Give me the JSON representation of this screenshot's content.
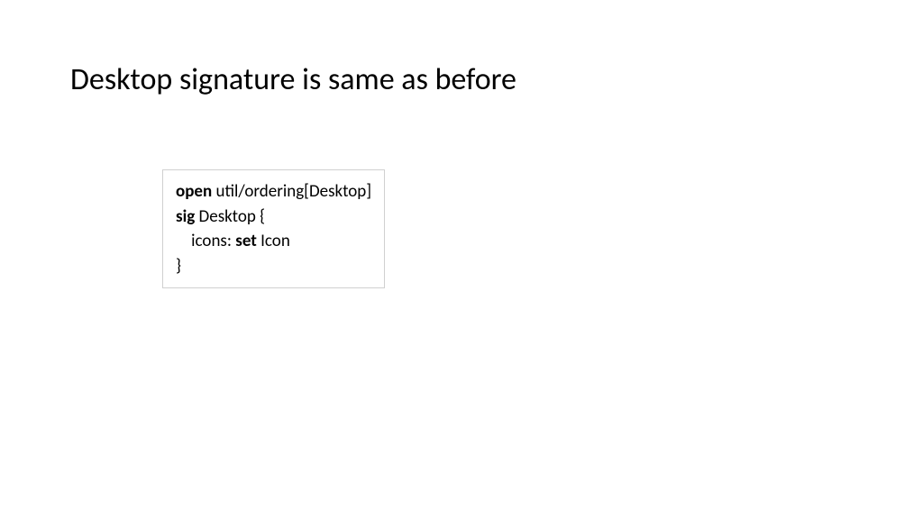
{
  "title": "Desktop signature is same as before",
  "code": {
    "line1": {
      "kw": "open",
      "rest": " util/ordering[Desktop]"
    },
    "line2": {
      "kw": "sig",
      "rest": " Desktop {"
    },
    "line3": {
      "indent": "    icons: ",
      "kw": "set",
      "rest": " Icon"
    },
    "line4": "}"
  }
}
